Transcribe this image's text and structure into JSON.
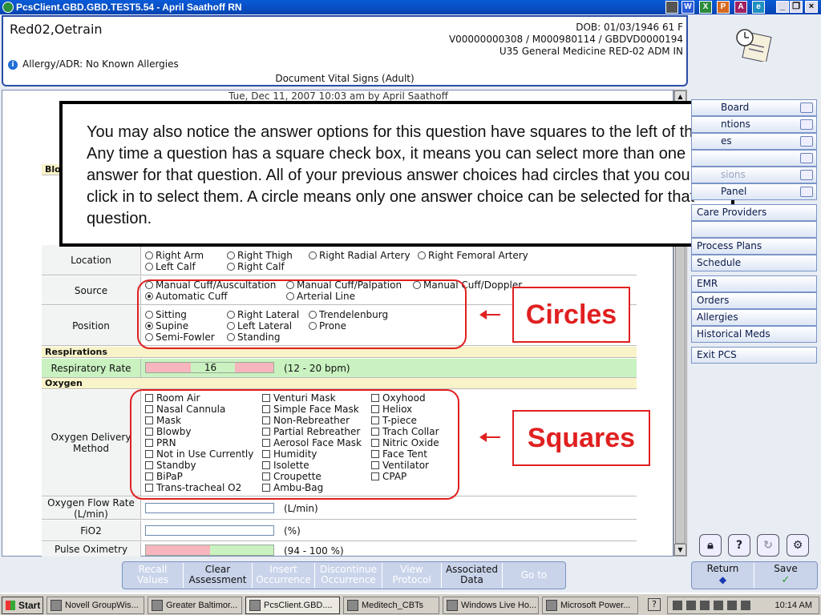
{
  "window": {
    "title": "PcsClient.GBD.GBD.TEST5.54 - April Saathoff RN"
  },
  "patient": {
    "name": "Red02,Oetrain",
    "dob": "DOB: 01/03/1946 61 F",
    "ids": "V00000000308 / M000980114 / GBDVD0000194",
    "location": "U35 General Medicine  RED-02  ADM IN",
    "allergy": "Allergy/ADR: No Known Allergies"
  },
  "document": {
    "title": "Document Vital Signs (Adult)",
    "date_line": "Tue, Dec 11, 2007 10:03 am  by  April Saathoff"
  },
  "popup": {
    "text": "You may also notice the answer options for this question have squares to the left of them. Any time a question has a square check box, it means you can select more than one answer for that question. All of your previous answer choices had circles that you could click in to select them. A circle means only one answer choice can be selected for that question."
  },
  "form": {
    "partial_section": "Blo",
    "location": {
      "label": "Location",
      "options": [
        "Right Arm",
        "Right Thigh",
        "Right Radial Artery",
        "Right Femoral Artery",
        "Left Calf",
        "Right Calf"
      ]
    },
    "source": {
      "label": "Source",
      "options": [
        "Manual Cuff/Auscultation",
        "Manual Cuff/Palpation",
        "Manual Cuff/Doppler",
        "Automatic Cuff",
        "Arterial Line"
      ],
      "selected": "Automatic Cuff"
    },
    "position": {
      "label": "Position",
      "options": [
        "Sitting",
        "Right Lateral",
        "Trendelenburg",
        "Supine",
        "Left Lateral",
        "Prone",
        "Semi-Fowler",
        "Standing"
      ],
      "selected": "Supine"
    },
    "respirations": {
      "header": "Respirations",
      "label": "Respiratory Rate",
      "value": "16",
      "range": "(12 - 20 bpm)"
    },
    "oxygen": {
      "header": "Oxygen",
      "delivery_label": "Oxygen Delivery Method",
      "col1": [
        "Room Air",
        "Nasal Cannula",
        "Mask",
        "Blowby",
        "PRN",
        "Not in Use Currently",
        "Standby",
        "BiPaP",
        "Trans-tracheal O2"
      ],
      "col2": [
        "Venturi Mask",
        "Simple Face Mask",
        "Non-Rebreather",
        "Partial Rebreather",
        "Aerosol Face Mask",
        "Humidity",
        "Isolette",
        "Croupette",
        "Ambu-Bag"
      ],
      "col3": [
        "Oxyhood",
        "Heliox",
        "T-piece",
        "Trach Collar",
        "Nitric Oxide",
        "Face Tent",
        "Ventilator",
        "CPAP"
      ],
      "flow_label": "Oxygen Flow Rate (L/min)",
      "flow_unit": "(L/min)",
      "fio2_label": "FiO2",
      "fio2_unit": "(%)",
      "pulse_label": "Pulse Oximetry",
      "pulse_range": "(94 - 100 %)"
    }
  },
  "annotations": {
    "circles": "Circles",
    "squares": "Squares"
  },
  "sidebar": [
    "Board",
    "ntions",
    "es",
    "",
    "sions",
    "Panel",
    "Care Providers",
    "",
    "Process Plans",
    "Schedule",
    "EMR",
    "Orders",
    "Allergies",
    "Historical Meds",
    "Exit PCS"
  ],
  "toolbar": [
    "Recall Values",
    "Clear Assessment",
    "Insert Occurrence",
    "Discontinue Occurrence",
    "View Protocol",
    "Associated Data",
    "Go to"
  ],
  "actions": {
    "return": "Return",
    "save": "Save"
  },
  "taskbar": {
    "start": "Start",
    "items": [
      "Novell GroupWis...",
      "Greater Baltimor...",
      "PcsClient.GBD....",
      "Meditech_CBTs",
      "Windows Live Ho...",
      "Microsoft Power..."
    ],
    "clock": "10:14 AM"
  },
  "colors": {
    "titlebar": "#0a5bd8",
    "accent_red": "#e02020",
    "normal_green": "#c9f2c0",
    "abnormal_pink": "#f7b5bd"
  }
}
